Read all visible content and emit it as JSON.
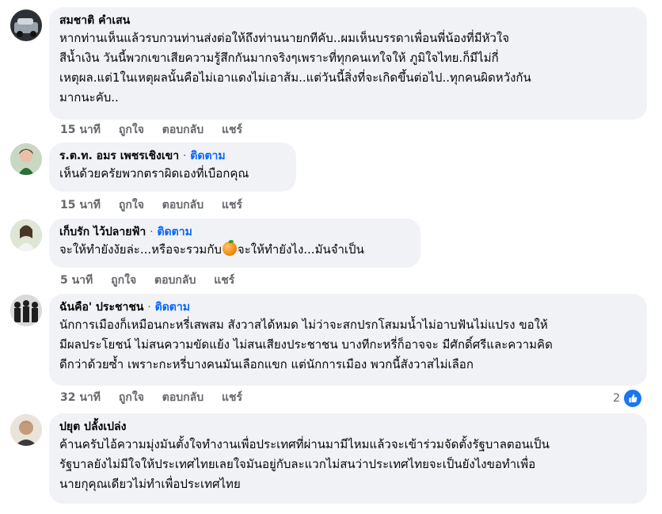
{
  "comments": [
    {
      "author": "สมชาติ คำเสน",
      "follow": "",
      "lines": [
        "หากท่านเห็นแล้วรบกวนท่านส่งต่อให้ถึงท่านนายกทีคับ..ผมเห็นบรรดาเพื่อนพี่น้องที่มีหัวใจ",
        "สีน้ำเงิน วันนี้พวกเขาเสียความรู้สึกกันมากจริงๆเพราะที่ทุกคนเทใจให้ ภูมิใจไทย.ก็มีไม่กี่",
        "เหตุผล.แต่1ในเหตุผลนั้นคือไม่เอาแดงไม่เอาส้ม..แต่วันนี้สิ่งที่จะเกิดขึ้นต่อไป..ทุกคนผิดหวังกัน",
        "มากนะคับ.."
      ],
      "time": "15 นาที",
      "like": "ถูกใจ",
      "reply": "ตอบกลับ",
      "share": "แชร์"
    },
    {
      "author": "ร.ต.ท. อมร เพชรเชิงเขา",
      "follow": "ติดตาม",
      "lines": [
        "เห็นด้วยครัยพวกตราผิดเองที่เบือกคุณ"
      ],
      "time": "15 นาที",
      "like": "ถูกใจ",
      "reply": "ตอบกลับ",
      "share": "แชร์"
    },
    {
      "author": "เก็บรัก ไว้ปลายฟ้า",
      "follow": "ติดตาม",
      "line_before_emoji": "จะให้ทำยังงัยล่ะ...หรือจะรวมกับ",
      "emoji": "orange-emoji",
      "line_after_emoji": "จะให้ทำยังไง...มันจำเป็น",
      "time": "5 นาที",
      "like": "ถูกใจ",
      "reply": "ตอบกลับ",
      "share": "แชร์"
    },
    {
      "author": "ฉันคือ' ประชาชน",
      "follow": "ติดตาม",
      "lines": [
        "นักการเมืองก็เหมือนกะหรี่เสพสม สังวาสได้หมด ไม่ว่าจะสกปรกโสมมน้ำไม่อาบฟันไม่แปรง ขอให้",
        "มีผลประโยชน์ ไม่สนความขัดแย้ง ไม่สนเสียงประชาชน บางทีกะหรี่ก็อาจจะ มีศักดิ์ศรีและความคิด",
        "ดีกว่าด้วยซ้ำ เพราะกะหรี่บางคนมันเลือกแขก แต่นักการเมือง พวกนี้สังวาสไม่เลือก"
      ],
      "time": "32 นาที",
      "like": "ถูกใจ",
      "reply": "ตอบกลับ",
      "share": "แชร์",
      "reaction_count": "2",
      "reaction_icon": "like-icon"
    },
    {
      "author": "ปยุต ปลั้งเปล่ง",
      "follow": "",
      "lines": [
        "ค้านครับไอ้ความมุ่งมันตั้งใจทำงานเพื่อประเทศที่ผ่านมามีไหมแล้วจะเข้าร่วมจัดตั้งรัฐบาลตอนเป็น",
        "รัฐบาลยังไม่มีใจให้ประเทศไทยเลยใจมันอยู่กับละแวกไม่สนว่าประเทศไทยจะเป็นยังไงขอทำเพื่อ",
        "นายกุคุณเดียวไม่ทำเพื่อประเทศไทย"
      ]
    }
  ],
  "separator_dot": "·",
  "colors": {
    "bubble": "#f0f2f5",
    "link": "#0866ff",
    "meta": "#65676b",
    "like": "#1877f2"
  }
}
